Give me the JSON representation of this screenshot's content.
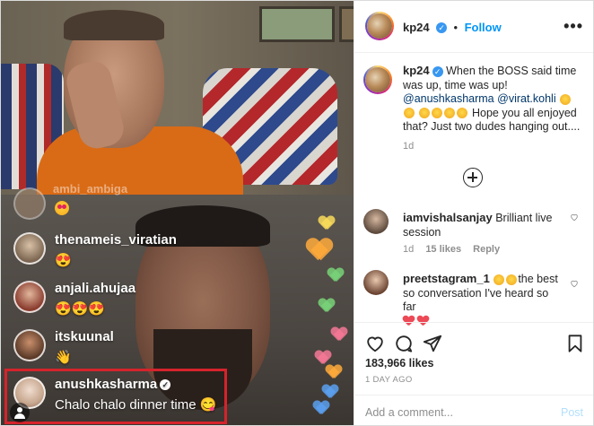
{
  "post": {
    "username": "kp24",
    "follow_label": "Follow",
    "more_label": "•••"
  },
  "live": {
    "ghost_comment_name": "ambi_ambiga",
    "comments": [
      {
        "name": "thenameis_viratian",
        "text": "😍"
      },
      {
        "name": "anjali.ahujaa",
        "text": "😍😍😍"
      },
      {
        "name": "itskuunal",
        "text": "👋"
      },
      {
        "name": "anushkasharma",
        "text": "Chalo chalo dinner time 😋",
        "highlighted": true
      }
    ]
  },
  "caption": {
    "username": "kp24",
    "text_1": "When the BOSS said time was up, time was up!",
    "mention_1": "@anushkasharma",
    "mention_2": "@virat.kohli",
    "text_2": "Hope you all enjoyed that? Just two dudes hanging out....",
    "age": "1d"
  },
  "comments": [
    {
      "username": "iamvishalsanjay",
      "text": "Brilliant live session",
      "age": "1d",
      "likes": "15 likes",
      "reply": "Reply"
    },
    {
      "username": "preetstagram_1",
      "text_a": "the best",
      "text_b": "so conversation I've heard so far"
    }
  ],
  "actions": {
    "likes": "183,966 likes",
    "time_ago": "1 DAY AGO",
    "comment_placeholder": "Add a comment...",
    "post_label": "Post"
  },
  "colors": {
    "highlight_border": "#d5232b",
    "follow_blue": "#0095f6",
    "verified_blue": "#3897f0"
  }
}
